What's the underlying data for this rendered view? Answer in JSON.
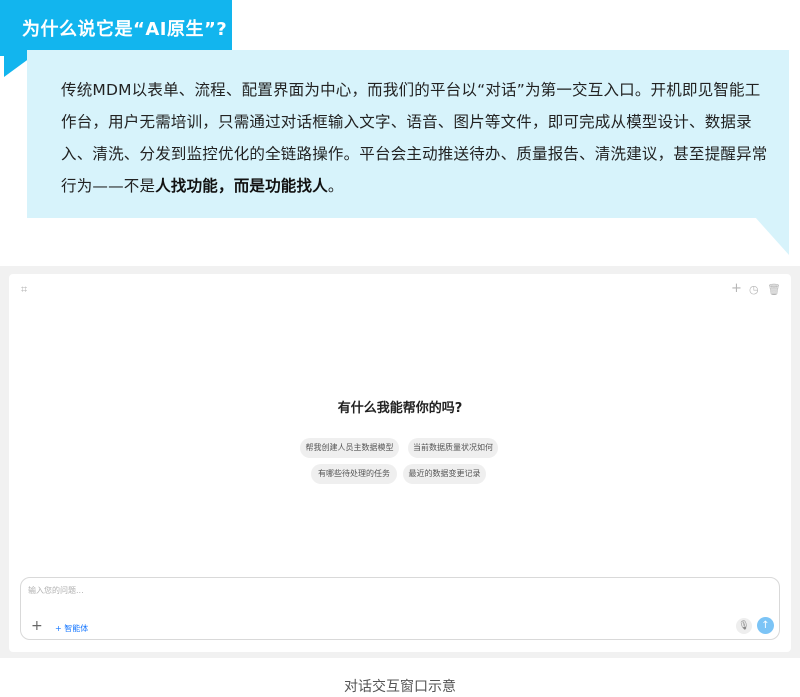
{
  "callout": {
    "title": "为什么说它是“AI原生”?",
    "body_part1": "传统MDM以表单、流程、配置界面为中心，而我们的平台以“对话”为第一交互入口。开机即见智能工作台，用户无需培训，只需通过对话框输入文字、语音、图片等文件，即可完成从模型设计、数据录入、清洗、分发到监控优化的全链路操作。平台会主动推送待办、质量报告、清洗建议，甚至提醒异常行为——不是",
    "body_bold": "人找功能，而是功能找人",
    "body_end": "。",
    "colors": {
      "accent": "#12b5ee",
      "bubble_bg": "#d7f3fb"
    }
  },
  "chat_window": {
    "toolbar_icons": [
      "crop-icon",
      "plus-icon",
      "history-icon",
      "trash-icon"
    ],
    "welcome_title": "有什么我能帮你的吗?",
    "suggestions": [
      "帮我创建人员主数据模型",
      "当前数据质量状况如何",
      "有哪些待处理的任务",
      "最近的数据变更记录"
    ],
    "input": {
      "placeholder": "输入您的问题...",
      "value": ""
    },
    "agent_button": "+ 智能体",
    "icons": {
      "attach": "plus-icon",
      "mic": "microphone-icon",
      "send": "send-arrow-icon"
    },
    "send_color": "#7cc4f6"
  },
  "caption": "对话交互窗口示意"
}
